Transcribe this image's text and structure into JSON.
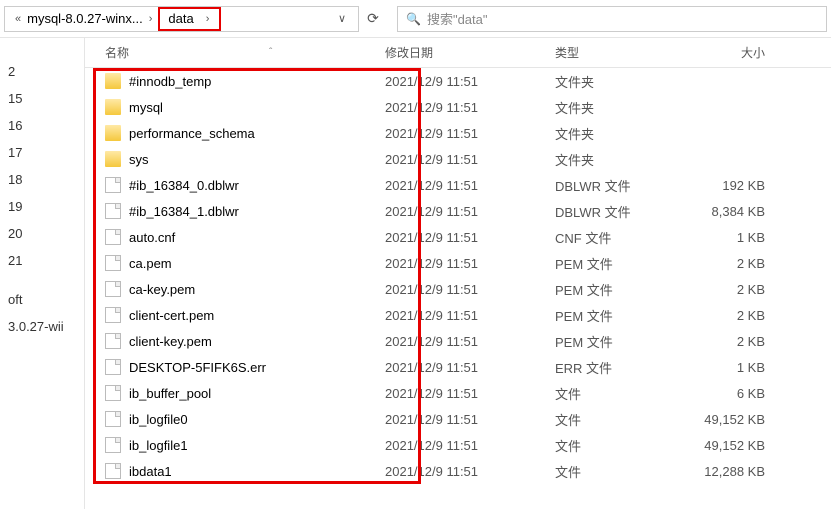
{
  "breadcrumb": {
    "back_chev": "«",
    "seg1": "mysql-8.0.27-winx...",
    "chev": "›",
    "seg2": "data",
    "dropdown": "∨"
  },
  "refresh_icon": "⟳",
  "search": {
    "icon": "🔍",
    "placeholder": "搜索\"data\""
  },
  "nav": {
    "items": [
      "2",
      "15",
      "16",
      "17",
      "18",
      "19",
      "20",
      "21",
      "",
      "oft",
      "3.0.27-wii"
    ]
  },
  "columns": {
    "name": "名称",
    "sort": "ˆ",
    "date": "修改日期",
    "type": "类型",
    "size": "大小"
  },
  "files": [
    {
      "icon": "folder",
      "name": "#innodb_temp",
      "date": "2021/12/9 11:51",
      "type": "文件夹",
      "size": ""
    },
    {
      "icon": "folder",
      "name": "mysql",
      "date": "2021/12/9 11:51",
      "type": "文件夹",
      "size": ""
    },
    {
      "icon": "folder",
      "name": "performance_schema",
      "date": "2021/12/9 11:51",
      "type": "文件夹",
      "size": ""
    },
    {
      "icon": "folder",
      "name": "sys",
      "date": "2021/12/9 11:51",
      "type": "文件夹",
      "size": ""
    },
    {
      "icon": "file",
      "name": "#ib_16384_0.dblwr",
      "date": "2021/12/9 11:51",
      "type": "DBLWR 文件",
      "size": "192 KB"
    },
    {
      "icon": "file",
      "name": "#ib_16384_1.dblwr",
      "date": "2021/12/9 11:51",
      "type": "DBLWR 文件",
      "size": "8,384 KB"
    },
    {
      "icon": "file",
      "name": "auto.cnf",
      "date": "2021/12/9 11:51",
      "type": "CNF 文件",
      "size": "1 KB"
    },
    {
      "icon": "file",
      "name": "ca.pem",
      "date": "2021/12/9 11:51",
      "type": "PEM 文件",
      "size": "2 KB"
    },
    {
      "icon": "file",
      "name": "ca-key.pem",
      "date": "2021/12/9 11:51",
      "type": "PEM 文件",
      "size": "2 KB"
    },
    {
      "icon": "file",
      "name": "client-cert.pem",
      "date": "2021/12/9 11:51",
      "type": "PEM 文件",
      "size": "2 KB"
    },
    {
      "icon": "file",
      "name": "client-key.pem",
      "date": "2021/12/9 11:51",
      "type": "PEM 文件",
      "size": "2 KB"
    },
    {
      "icon": "file",
      "name": "DESKTOP-5FIFK6S.err",
      "date": "2021/12/9 11:51",
      "type": "ERR 文件",
      "size": "1 KB"
    },
    {
      "icon": "file",
      "name": "ib_buffer_pool",
      "date": "2021/12/9 11:51",
      "type": "文件",
      "size": "6 KB"
    },
    {
      "icon": "file",
      "name": "ib_logfile0",
      "date": "2021/12/9 11:51",
      "type": "文件",
      "size": "49,152 KB"
    },
    {
      "icon": "file",
      "name": "ib_logfile1",
      "date": "2021/12/9 11:51",
      "type": "文件",
      "size": "49,152 KB"
    },
    {
      "icon": "file",
      "name": "ibdata1",
      "date": "2021/12/9 11:51",
      "type": "文件",
      "size": "12,288 KB"
    }
  ]
}
